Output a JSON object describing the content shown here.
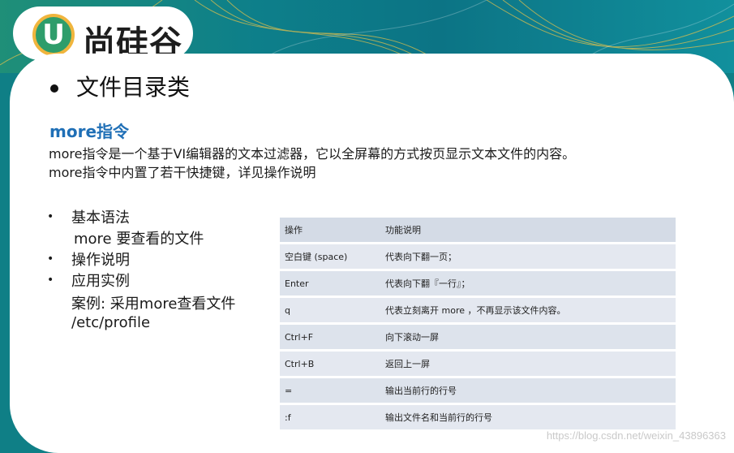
{
  "logo": {
    "letter": "U",
    "text": "尚硅谷"
  },
  "section_title": "文件目录类",
  "command": {
    "title": "more指令",
    "description_lines": [
      "more指令是一个基于VI编辑器的文本过滤器，它以全屏幕的方式按页显示文本文件的内容。",
      "more指令中内置了若干快捷键，详见操作说明"
    ]
  },
  "items": {
    "syntax_label": "基本语法",
    "syntax_value": "more 要查看的文件",
    "ops_label": "操作说明",
    "example_label": "应用实例",
    "example_text": "案例: 采用more查看文件",
    "example_path": "/etc/profile"
  },
  "table": {
    "header": [
      "操作",
      "功能说明"
    ],
    "rows": [
      [
        "空白键 (space)",
        "代表向下翻一页；"
      ],
      [
        "Enter",
        "代表向下翻『一行』；"
      ],
      [
        "q",
        "代表立刻离开 more ，不再显示该文件内容。"
      ],
      [
        "Ctrl+F",
        "向下滚动一屏"
      ],
      [
        "Ctrl+B",
        "返回上一屏"
      ],
      [
        "=",
        "输出当前行的行号"
      ],
      [
        ":f",
        "输出文件名和当前行的行号"
      ]
    ]
  },
  "watermark": "https://blog.csdn.net/weixin_43896363",
  "colors": {
    "accent": "#1f6fb6",
    "teal": "#0f7f86",
    "logo_green": "#2e9d6b",
    "logo_ring": "#f0b53d"
  }
}
